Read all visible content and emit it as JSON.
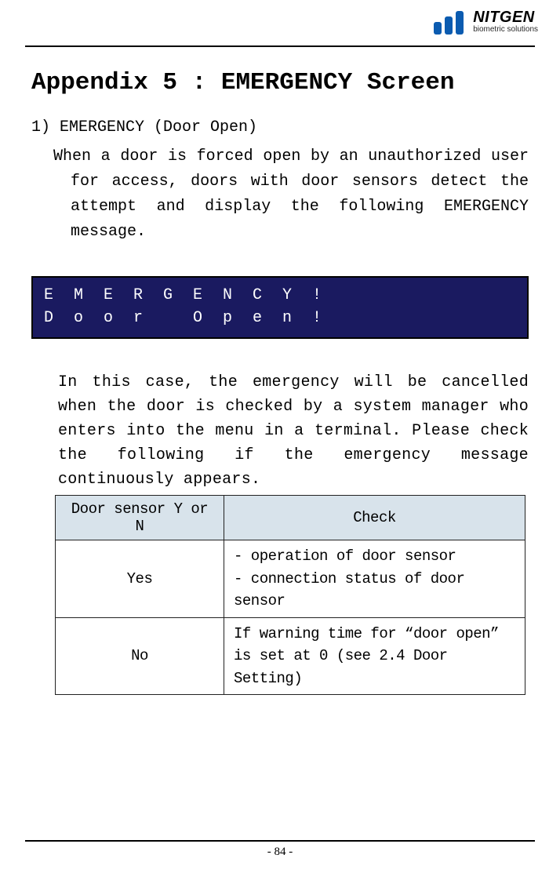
{
  "brand": {
    "name": "NITGEN",
    "tag": "biometric solutions",
    "bar_color1": "#0b5bb0",
    "bar_color2": "#0b5bb0",
    "bar_color3": "#0b5bb0"
  },
  "title": "Appendix 5 : EMERGENCY Screen",
  "section_head": "1) EMERGENCY (Door Open)",
  "para1": "When a door is forced open by an unauthorized user for access, doors with door sensors detect the attempt and display the following EMERGENCY message.",
  "lcd": {
    "row1": [
      "E",
      "M",
      "E",
      "R",
      "G",
      "E",
      "N",
      "C",
      "Y",
      "!"
    ],
    "row2": [
      "D",
      "o",
      "o",
      "r",
      "",
      "O",
      "p",
      "e",
      "n",
      "!"
    ]
  },
  "para2": "In this case, the emergency will be cancelled when the door is checked by a system manager who enters into the menu in a terminal. Please check the following if the emergency message continuously appears.",
  "table": {
    "head": [
      "Door sensor Y or N",
      "Check"
    ],
    "rows": [
      {
        "cat": "Yes",
        "desc": "- operation of door sensor\n- connection status of door sensor"
      },
      {
        "cat": "No",
        "desc": "If warning time for “door open” is set at 0 (see 2.4 Door Setting)"
      }
    ]
  },
  "page_no": "- 84 -"
}
